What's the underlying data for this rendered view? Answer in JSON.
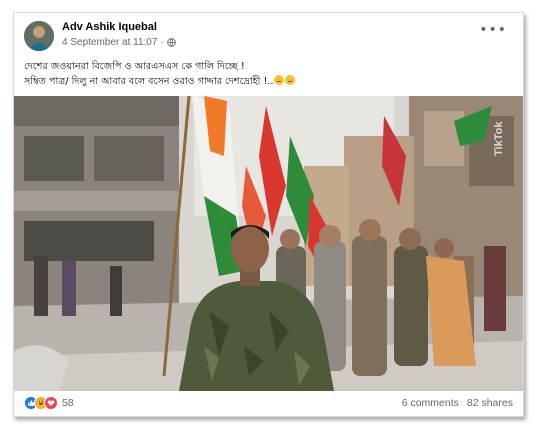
{
  "post": {
    "author": "Adv Ashik Iquebal",
    "date": "4 September at 11:07",
    "separator": "·",
    "more_label": "•••",
    "caption_lines": [
      "দেশের জওয়ানরা বিজেপি ও আরএসএস কে গালি দিচ্ছে !",
      "সম্বিত পাত্র/ দিলু না আবার বলে বসেন ওরাও গাদ্দার দেশদ্রোহী !.."
    ],
    "caption_emoji": [
      "thinking-face-emoji",
      "thinking-face-emoji"
    ],
    "watermark": "TikTok"
  },
  "footer": {
    "reaction_icons": [
      "like-icon",
      "haha-icon",
      "love-icon"
    ],
    "reaction_count": "58",
    "comments": "6 comments",
    "shares": "82 shares"
  },
  "colors": {
    "accent": "#1877f2",
    "secondary_text": "#65676b",
    "saffron": "#f07a2a",
    "flag_green": "#2e8b3a",
    "uniform": "#4f5a3a"
  }
}
